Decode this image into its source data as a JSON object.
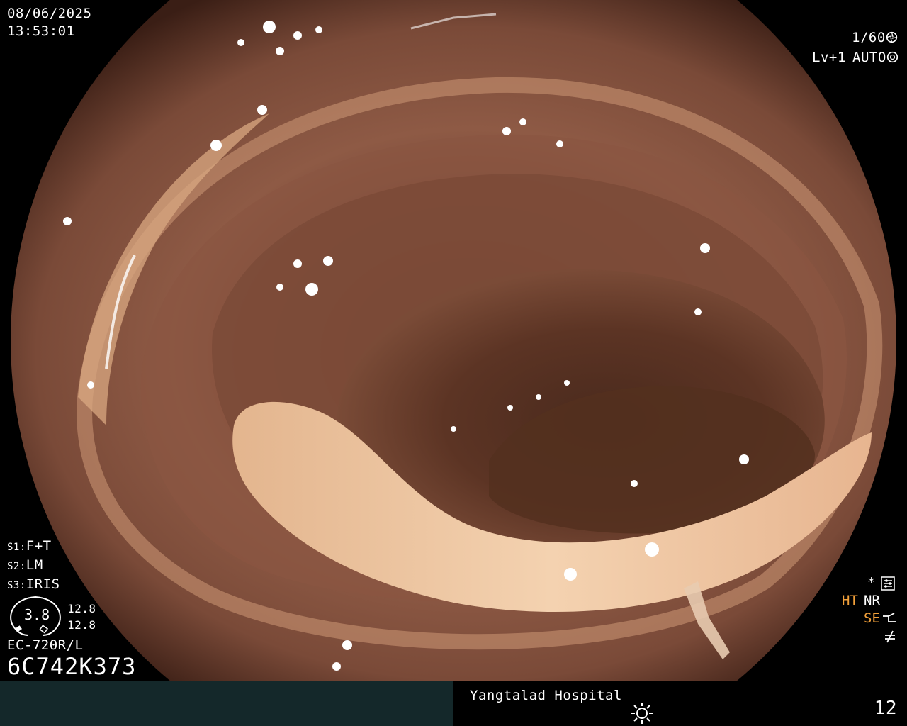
{
  "header": {
    "date": "08/06/2025",
    "time": "13:53:01",
    "shutter": "1/60",
    "level": "Lv+1",
    "iris_mode": "AUTO"
  },
  "settings": {
    "s1_key": "S1:",
    "s1_value": "F+T",
    "s2_key": "S2:",
    "s2_value": "LM",
    "s3_key": "S3:",
    "s3_value": "IRIS"
  },
  "zoom": {
    "value": "3.8",
    "side_top": "12.8",
    "side_bottom": "12.8"
  },
  "scope": {
    "model": "EC-720R/L",
    "serial": "6C742K373"
  },
  "status": {
    "star": "*",
    "ht": "HT",
    "nr": "NR",
    "se": "SE"
  },
  "footer": {
    "hospital": "Yangtalad Hospital",
    "page_number": "12"
  },
  "colors": {
    "orange_indicator": "#f2a03a",
    "footer_bar": "#14282a"
  },
  "icons": {
    "shutter": "aperture-icon",
    "iris": "iris-icon",
    "record": "record-settings-icon",
    "se": "se-mode-icon",
    "brightness": "sun-icon"
  }
}
